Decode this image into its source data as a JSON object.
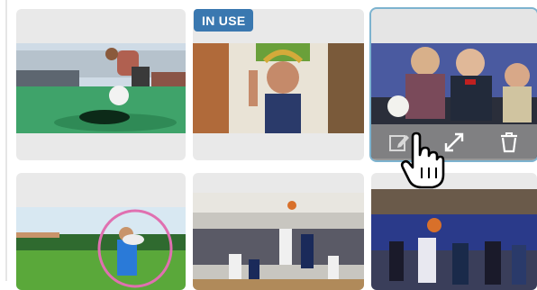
{
  "gallery": {
    "badge_label": "IN USE",
    "cards": [
      {
        "thumb_icon": "golf-putting-photo"
      },
      {
        "thumb_icon": "person-with-decoration-photo",
        "in_use": true
      },
      {
        "thumb_icon": "homecoming-court-photo",
        "selected": true
      },
      {
        "thumb_icon": "hula-hoop-photo"
      },
      {
        "thumb_icon": "basketball-game-photo"
      },
      {
        "thumb_icon": "basketball-crowd-photo"
      }
    ],
    "toolbar": {
      "edit_icon": "edit-icon",
      "expand_icon": "expand-icon",
      "delete_icon": "trash-icon"
    }
  },
  "colors": {
    "badge": "#3a78b0",
    "selection": "#7db3cf",
    "card": "#e9e9e9"
  }
}
